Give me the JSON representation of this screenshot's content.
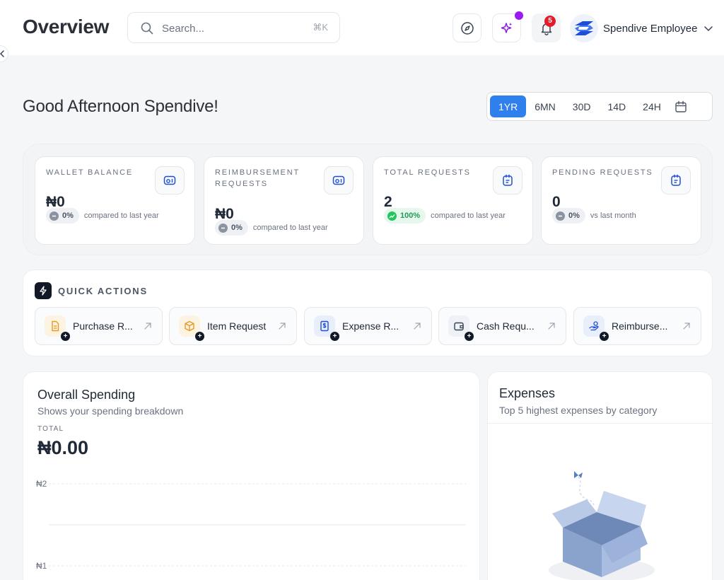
{
  "header": {
    "title": "Overview",
    "search": {
      "placeholder": "Search...",
      "shortcut": "⌘K"
    },
    "notifications_count": "5",
    "user": {
      "name": "Spendive Employee"
    }
  },
  "greeting": "Good Afternoon Spendive!",
  "time_range": {
    "options": [
      "1YR",
      "6MN",
      "30D",
      "14D",
      "24H"
    ],
    "selected": "1YR"
  },
  "stats": [
    {
      "label": "WALLET BALANCE",
      "value": "₦0",
      "change": "0%",
      "trend": "neutral",
      "compare": "compared to last year"
    },
    {
      "label": "REIMBURSEMENT REQUESTS",
      "value": "₦0",
      "change": "0%",
      "trend": "neutral",
      "compare": "compared to last year"
    },
    {
      "label": "TOTAL REQUESTS",
      "value": "2",
      "change": "100%",
      "trend": "up",
      "compare": "compared to last year"
    },
    {
      "label": "PENDING REQUESTS",
      "value": "0",
      "change": "0%",
      "trend": "neutral",
      "compare": "vs last month"
    }
  ],
  "quick_actions": {
    "title": "QUICK ACTIONS",
    "items": [
      {
        "label": "Purchase R...",
        "icon": "document-icon"
      },
      {
        "label": "Item Request",
        "icon": "package-icon"
      },
      {
        "label": "Expense R...",
        "icon": "receipt-dollar-icon"
      },
      {
        "label": "Cash Requ...",
        "icon": "wallet-icon"
      },
      {
        "label": "Reimburse...",
        "icon": "hand-coins-icon"
      }
    ]
  },
  "spending": {
    "title": "Overall Spending",
    "subtitle": "Shows your spending breakdown",
    "total_label": "TOTAL",
    "total_value": "₦0.00"
  },
  "chart_data": {
    "type": "line",
    "title": "Overall Spending",
    "y_ticks": [
      "₦2",
      "₦1"
    ],
    "ylim": [
      0,
      2
    ],
    "grid": true,
    "series": []
  },
  "expenses": {
    "title": "Expenses",
    "subtitle": "Top 5 highest expenses by category",
    "empty_illustration": "empty-box-icon"
  },
  "colors": {
    "accent": "#2f80ed",
    "positive": "#22c55e",
    "notification": "#e11d2a",
    "ai_dot": "#9b1cf0"
  }
}
